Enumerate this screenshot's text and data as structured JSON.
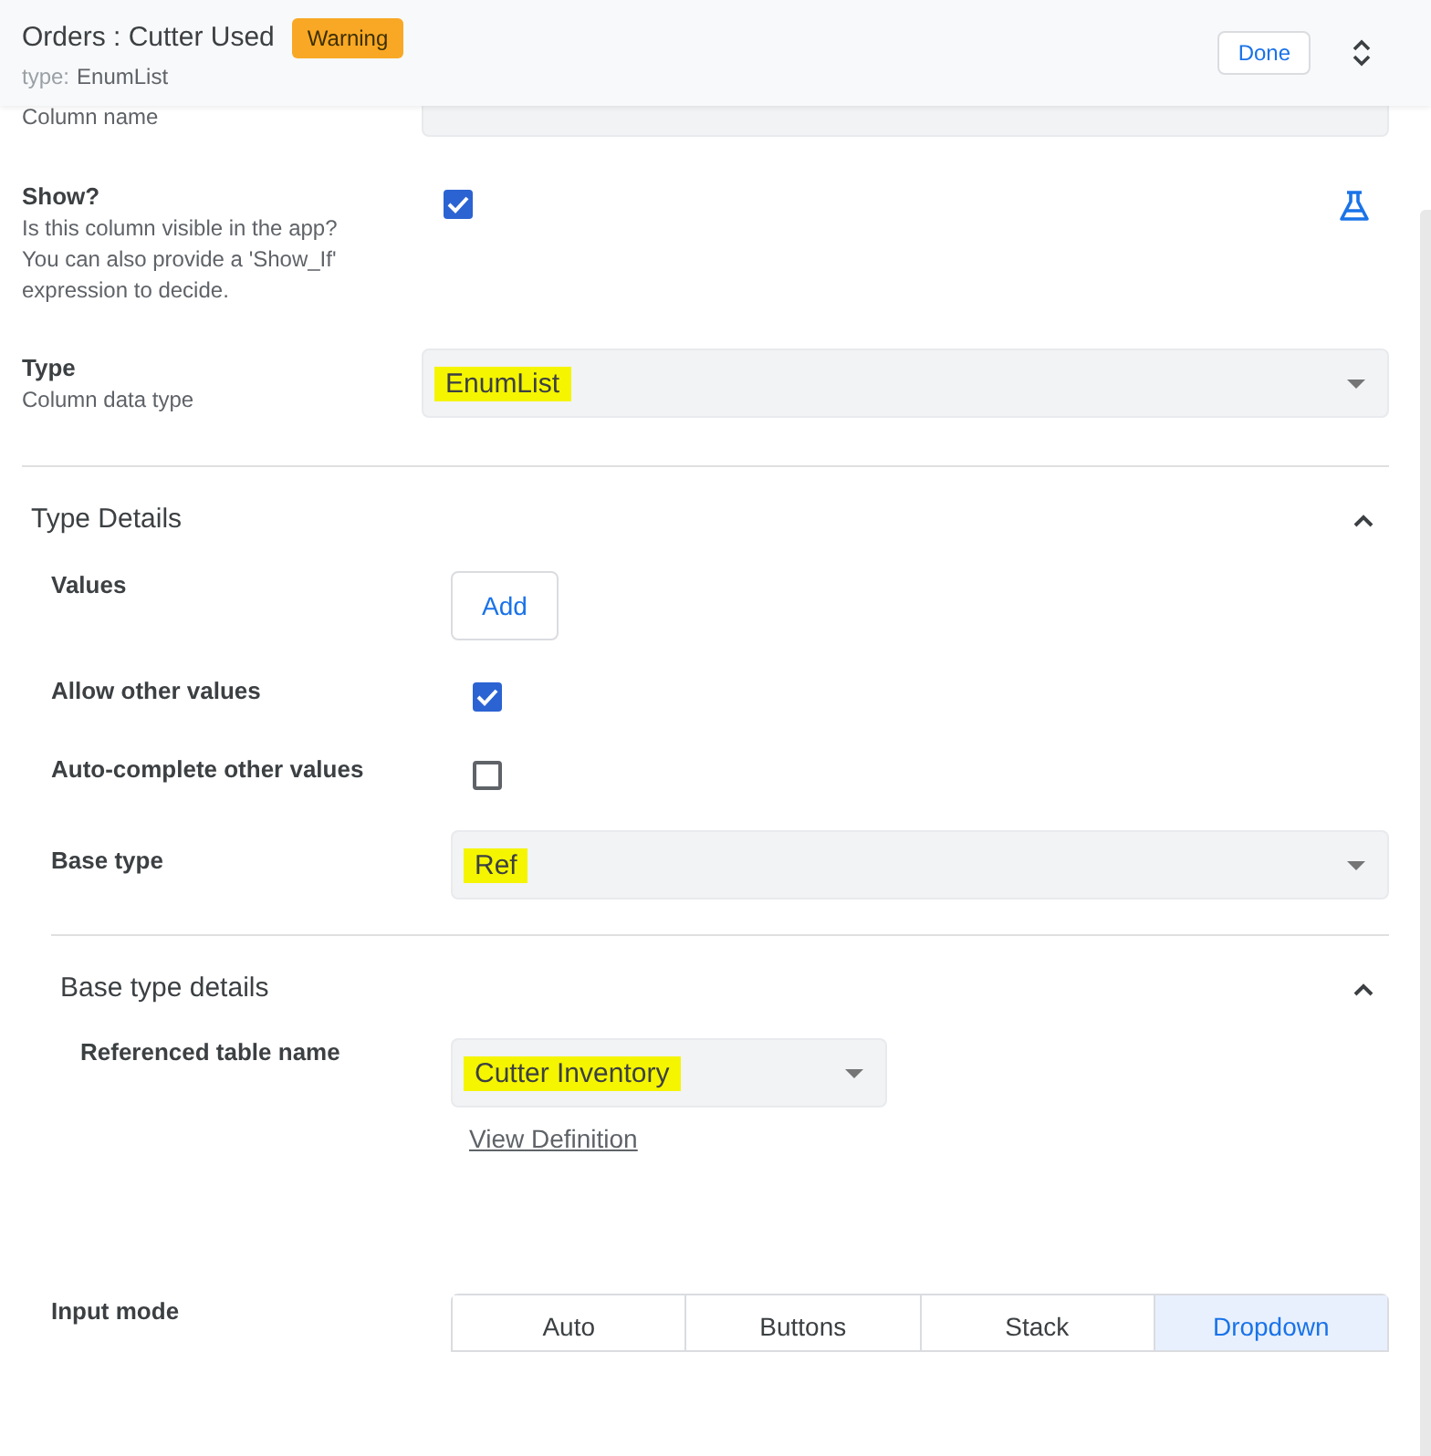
{
  "header": {
    "title": "Orders : Cutter Used",
    "badge": "Warning",
    "subtitle_prefix": "type:",
    "subtitle_value": "EnumList",
    "done_button": "Done"
  },
  "column_name": {
    "label": "Column name"
  },
  "show": {
    "label": "Show?",
    "description": "Is this column visible in the app? You can also provide a 'Show_If' expression to decide.",
    "checked": true
  },
  "type": {
    "label": "Type",
    "description": "Column data type",
    "value": "EnumList",
    "highlighted": true
  },
  "type_details": {
    "title": "Type Details",
    "expanded": true,
    "values": {
      "label": "Values",
      "button": "Add"
    },
    "allow_other_values": {
      "label": "Allow other values",
      "checked": true
    },
    "auto_complete": {
      "label": "Auto-complete other values",
      "checked": false
    },
    "base_type": {
      "label": "Base type",
      "value": "Ref",
      "highlighted": true
    },
    "base_type_details": {
      "title": "Base type details",
      "expanded": true,
      "referenced_table": {
        "label": "Referenced table name",
        "value": "Cutter Inventory",
        "highlighted": true,
        "link": "View Definition"
      }
    },
    "input_mode": {
      "label": "Input mode",
      "options": [
        {
          "label": "Auto",
          "selected": false
        },
        {
          "label": "Buttons",
          "selected": false
        },
        {
          "label": "Stack",
          "selected": false
        },
        {
          "label": "Dropdown",
          "selected": true
        }
      ]
    }
  }
}
